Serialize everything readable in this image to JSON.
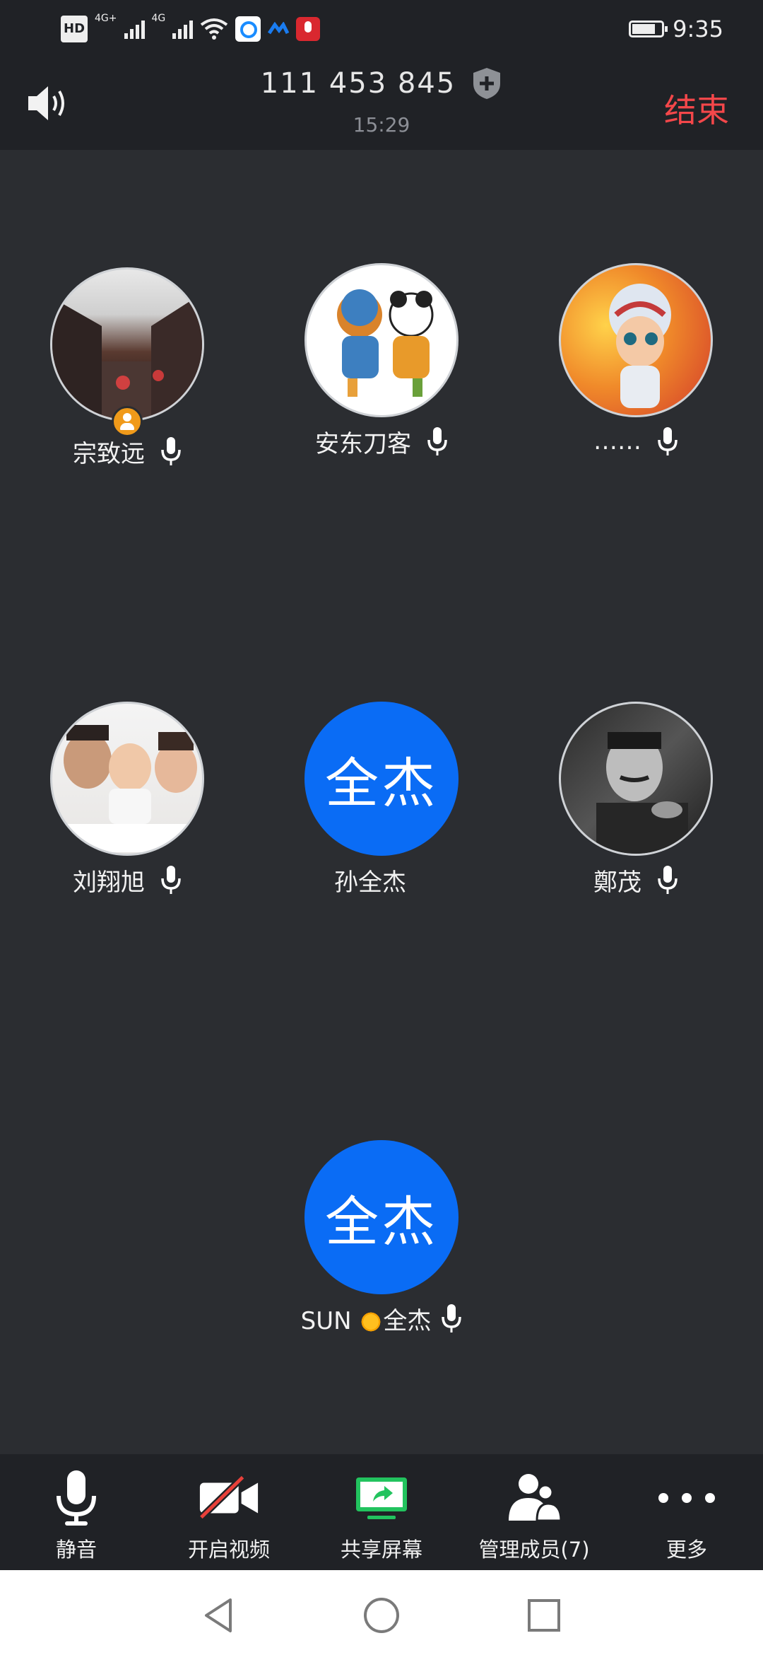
{
  "status_bar": {
    "network_label_1": "4G+",
    "network_label_2": "4G",
    "hd": "HD",
    "time": "9:35"
  },
  "header": {
    "meeting_id": "111 453 845",
    "duration": "15:29",
    "end_label": "结束"
  },
  "participants": [
    {
      "name": "宗致远",
      "avatar": "photo-street",
      "is_host": true,
      "mic": true
    },
    {
      "name": "安东刀客",
      "avatar": "cartoon-panda-pair",
      "mic": true
    },
    {
      "name": "……",
      "avatar": "cartoon-kid-helmet",
      "mic": true
    },
    {
      "name": "刘翔旭",
      "avatar": "photo-family",
      "mic": true
    },
    {
      "name": "孙全杰",
      "avatar_text": "全杰",
      "mic": false
    },
    {
      "name": "鄭茂",
      "avatar": "photo-portrait-bw",
      "mic": true
    },
    {
      "name_prefix": "SUN",
      "name_suffix": "全杰",
      "avatar_text": "全杰",
      "mic": true
    }
  ],
  "toolbar": {
    "mute_label": "静音",
    "video_label": "开启视频",
    "share_label": "共享屏幕",
    "members_label": "管理成员(7)",
    "more_label": "更多"
  },
  "colors": {
    "background": "#2b2d31",
    "bar": "#202226",
    "accent_blue": "#0a6cf5",
    "end_red": "#f4474a",
    "share_green": "#22c35e"
  }
}
